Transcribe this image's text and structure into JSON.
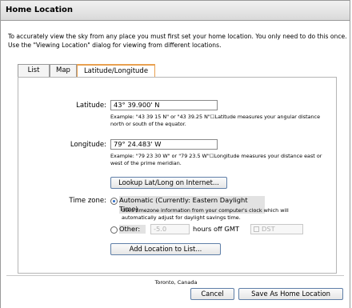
{
  "window": {
    "title": "Home Location"
  },
  "intro": "To accurately view the sky from any place you must first set your home location. You only need to do this once. Use the \"Viewing Location\" dialog for viewing from different locations.",
  "tabs": [
    {
      "label": "List",
      "active": false
    },
    {
      "label": "Map",
      "active": false
    },
    {
      "label": "Latitude/Longitude",
      "active": true
    }
  ],
  "latitude": {
    "label": "Latitude:",
    "value": "43° 39.900' N",
    "hint": "Example: \"43 39 15 N\" or \"43 39.25 N\"☐Latitude measures your angular distance north or south of the equator."
  },
  "longitude": {
    "label": "Longitude:",
    "value": "79° 24.483' W",
    "hint": "Example: \"79 23 30 W\" or \"79 23.5 W\"☐Longitude measures your distance east or west of the prime meridian."
  },
  "lookup_button": "Lookup Lat/Long on Internet...",
  "timezone": {
    "label": "Time zone:",
    "automatic_label": "Automatic (Currently: Eastern Daylight Time)",
    "automatic_hint": "Uses timezone information from your computer's clock which will automatically adjust for daylight savings time.",
    "other_label": "Other:",
    "offset_value": "-5.0",
    "offset_suffix": "hours off GMT",
    "dst_label": "DST",
    "selected": "automatic"
  },
  "add_location_button": "Add Location to List...",
  "status_location": "Toronto, Canada",
  "cancel_button": "Cancel",
  "save_button": "Save As Home Location"
}
